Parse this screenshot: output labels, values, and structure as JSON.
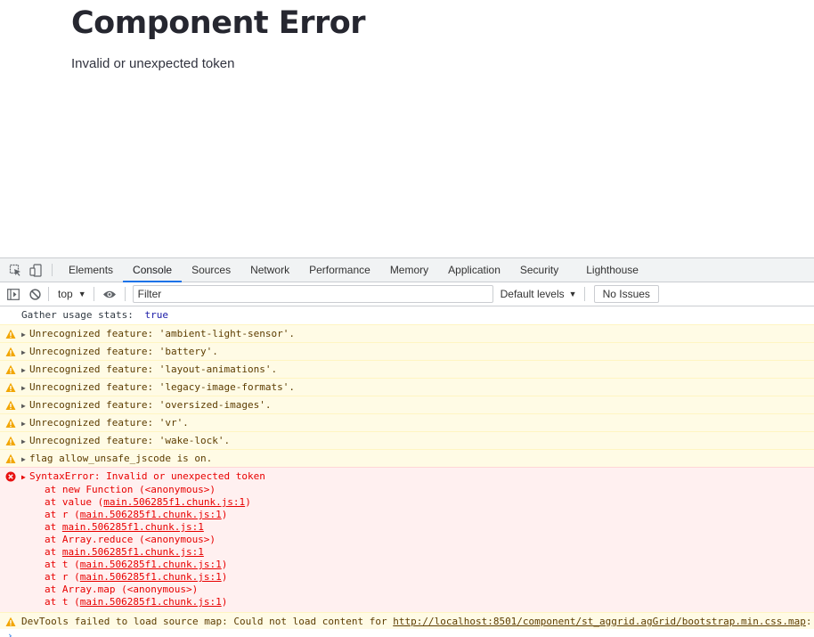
{
  "page": {
    "title": "Component Error",
    "message": "Invalid or unexpected token"
  },
  "devtools": {
    "tabs": [
      {
        "label": "Elements"
      },
      {
        "label": "Console"
      },
      {
        "label": "Sources"
      },
      {
        "label": "Network"
      },
      {
        "label": "Performance"
      },
      {
        "label": "Memory"
      },
      {
        "label": "Application"
      },
      {
        "label": "Security"
      },
      {
        "label": "Lighthouse"
      }
    ],
    "active_tab": "Console",
    "toolbar": {
      "context": "top",
      "filter_placeholder": "Filter",
      "levels_label": "Default levels",
      "issues_label": "No Issues"
    },
    "info": {
      "key": "Gather usage stats:",
      "value": "true"
    },
    "warnings": [
      "Unrecognized feature: 'ambient-light-sensor'.",
      "Unrecognized feature: 'battery'.",
      "Unrecognized feature: 'layout-animations'.",
      "Unrecognized feature: 'legacy-image-formats'.",
      "Unrecognized feature: 'oversized-images'.",
      "Unrecognized feature: 'vr'.",
      "Unrecognized feature: 'wake-lock'.",
      "flag allow_unsafe_jscode is on."
    ],
    "error": {
      "message": "SyntaxError: Invalid or unexpected token",
      "stack": [
        {
          "text": "at new Function (<anonymous>)",
          "pre": "at new Function (<anonymous>)",
          "link": "",
          "post": ""
        },
        {
          "text": "",
          "pre": "at value (",
          "link": "main.506285f1.chunk.js:1",
          "post": ")"
        },
        {
          "text": "",
          "pre": "at r (",
          "link": "main.506285f1.chunk.js:1",
          "post": ")"
        },
        {
          "text": "",
          "pre": "at ",
          "link": "main.506285f1.chunk.js:1",
          "post": ""
        },
        {
          "text": "at Array.reduce (<anonymous>)",
          "pre": "at Array.reduce (<anonymous>)",
          "link": "",
          "post": ""
        },
        {
          "text": "",
          "pre": "at ",
          "link": "main.506285f1.chunk.js:1",
          "post": ""
        },
        {
          "text": "",
          "pre": "at t (",
          "link": "main.506285f1.chunk.js:1",
          "post": ")"
        },
        {
          "text": "",
          "pre": "at r (",
          "link": "main.506285f1.chunk.js:1",
          "post": ")"
        },
        {
          "text": "at Array.map (<anonymous>)",
          "pre": "at Array.map (<anonymous>)",
          "link": "",
          "post": ""
        },
        {
          "text": "",
          "pre": "at t (",
          "link": "main.506285f1.chunk.js:1",
          "post": ")"
        }
      ]
    },
    "sourcemap_warning": {
      "pre": "DevTools failed to load source map: Could not load content for ",
      "link": "http://localhost:8501/component/st_aggrid.agGrid/bootstrap.min.css.map",
      "post": ":"
    },
    "prompt_symbol": "›"
  },
  "colors": {
    "accent": "#1a73e8",
    "warning_bg": "#fffbe5",
    "error_bg": "#fff0f0",
    "error_text": "#e80000",
    "warning_text": "#5c3c00"
  }
}
